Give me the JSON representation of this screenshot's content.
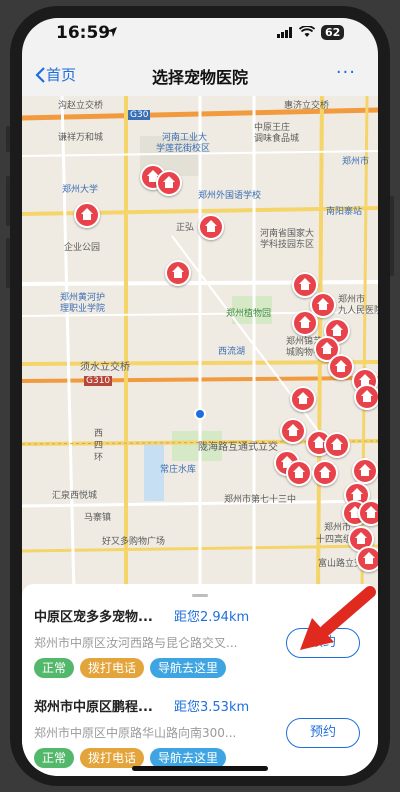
{
  "status_bar": {
    "time": "16:59",
    "battery": "62"
  },
  "navbar": {
    "back_label": "首页",
    "title": "选择宠物医院",
    "more": "···"
  },
  "map": {
    "labels": [
      {
        "text": "沟赵立交桥"
      },
      {
        "text": "G30"
      },
      {
        "text": "惠济立交桥"
      },
      {
        "text": "谦祥万和城"
      },
      {
        "text": "河南工业大"
      },
      {
        "text": "学莲花街校区"
      },
      {
        "text": "中原王庄"
      },
      {
        "text": "调味食品城"
      },
      {
        "text": "郑州大学"
      },
      {
        "text": "郑州外国语学校"
      },
      {
        "text": "南阳寨站"
      },
      {
        "text": "郑州市"
      },
      {
        "text": "正弘"
      },
      {
        "text": "河南省国家大"
      },
      {
        "text": "学科技园东区"
      },
      {
        "text": "企业公园"
      },
      {
        "text": "郑州黄河护"
      },
      {
        "text": "理职业学院"
      },
      {
        "text": "郑州植物园"
      },
      {
        "text": "郑州市"
      },
      {
        "text": "九人民医院"
      },
      {
        "text": "郑州锦艺"
      },
      {
        "text": "城购物中心"
      },
      {
        "text": "西流湖"
      },
      {
        "text": "须水立交桥"
      },
      {
        "text": "G310"
      },
      {
        "text": "西"
      },
      {
        "text": "四"
      },
      {
        "text": "环"
      },
      {
        "text": "常庄水库"
      },
      {
        "text": "陇海路互通式立交"
      },
      {
        "text": "汇泉西悦城"
      },
      {
        "text": "郑州市第七十三中"
      },
      {
        "text": "好又多购物广场"
      },
      {
        "text": "郑州市"
      },
      {
        "text": "十四高级中"
      },
      {
        "text": "富山路立交"
      },
      {
        "text": "马寨镇"
      }
    ]
  },
  "cards": [
    {
      "name": "中原区宠多多宠物...",
      "distance": "距您2.94km",
      "address": "郑州市中原区汝河西路与昆仑路交叉...",
      "tags": [
        "正常",
        "拨打电话",
        "导航去这里"
      ],
      "book_label": "预约"
    },
    {
      "name": "郑州市中原区鹏程...",
      "distance": "距您3.53km",
      "address": "郑州市中原区中原路华山路向南300...",
      "tags": [
        "正常",
        "拨打电话",
        "导航去这里"
      ],
      "book_label": "预约"
    }
  ],
  "colors": {
    "accent": "#1e6fdc",
    "pin": "#e8424b",
    "tag_green": "#53b86b",
    "tag_yellow": "#e3a43b",
    "tag_blue": "#3ea5e2"
  }
}
